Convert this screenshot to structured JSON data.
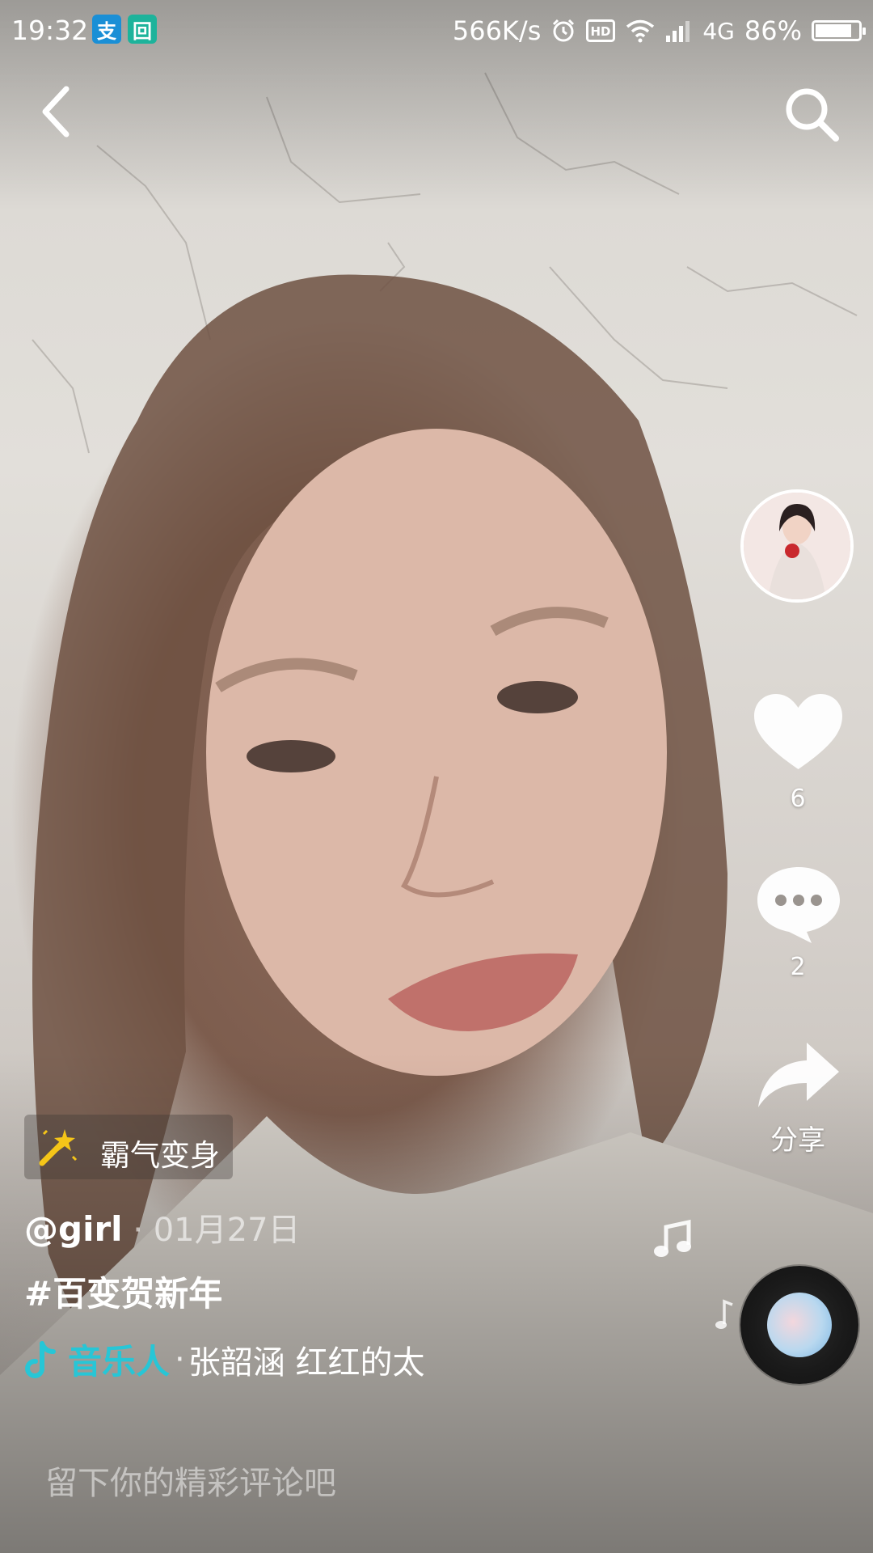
{
  "status_bar": {
    "time": "19:32",
    "app_icons": [
      {
        "name": "alipay-icon",
        "glyph": "支",
        "color": "#1a8fd6"
      },
      {
        "name": "scan-app-icon",
        "glyph": "回",
        "color": "#1db39b"
      }
    ],
    "network_speed": "566K/s",
    "network_type": "4G",
    "battery_percent": "86%",
    "battery_level": 0.86
  },
  "top_bar": {
    "back_icon": "chevron-left-icon",
    "search_icon": "search-icon"
  },
  "side_rail": {
    "like_count": "6",
    "comment_count": "2",
    "share_label": "分享"
  },
  "effect": {
    "label": "霸气变身",
    "icon": "magic-wand-icon",
    "icon_color": "#f5c518"
  },
  "post": {
    "author": "@girl",
    "date": " · 01月27日",
    "hashtag": "#百变贺新年",
    "music_artist_label": "音乐人",
    "music_separator": "·",
    "music_title": "张韶涵 红红的太",
    "accent_color": "#27c6d6"
  },
  "comment": {
    "placeholder": "留下你的精彩评论吧"
  }
}
